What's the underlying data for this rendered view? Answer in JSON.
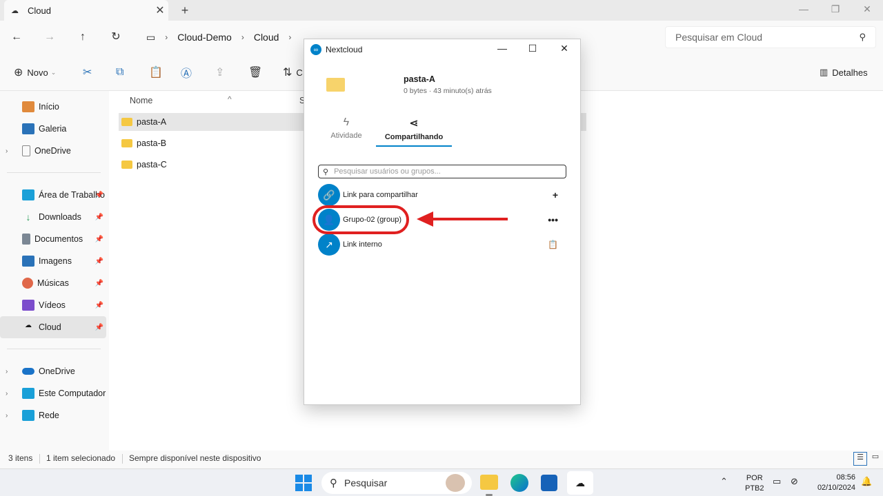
{
  "window": {
    "tab_title": "Cloud",
    "new_tab_symbol": "+",
    "close_symbol": "✕"
  },
  "nav": {
    "breadcrumb": [
      "Cloud-Demo",
      "Cloud"
    ],
    "search_placeholder": "Pesquisar em Cloud"
  },
  "commands": {
    "new_label": "Novo",
    "details_label": "Detalhes",
    "sort_label": "C"
  },
  "sidebar": {
    "items": [
      {
        "label": "Início",
        "icon": "home-icon",
        "color": "#e08a3c"
      },
      {
        "label": "Galeria",
        "icon": "gallery-icon",
        "color": "#2a72b8"
      },
      {
        "label": "OneDrive",
        "icon": "document-icon",
        "color": "#ffffff"
      },
      {
        "label": "Área de Trabalho",
        "icon": "desktop-icon",
        "color": "#1aa0d8"
      },
      {
        "label": "Downloads",
        "icon": "download-icon",
        "color": "#2a9d5a"
      },
      {
        "label": "Documentos",
        "icon": "documents-icon",
        "color": "#7b8794"
      },
      {
        "label": "Imagens",
        "icon": "pictures-icon",
        "color": "#2a72b8"
      },
      {
        "label": "Músicas",
        "icon": "music-icon",
        "color": "#e0684a"
      },
      {
        "label": "Vídeos",
        "icon": "videos-icon",
        "color": "#7c4dcc"
      },
      {
        "label": "Cloud",
        "icon": "nextcloud-icon",
        "color": "#333333"
      },
      {
        "label": "OneDrive",
        "icon": "onedrive-icon",
        "color": "#1a73c8"
      },
      {
        "label": "Este Computador",
        "icon": "computer-icon",
        "color": "#1aa0d8"
      },
      {
        "label": "Rede",
        "icon": "network-icon",
        "color": "#1aa0d8"
      }
    ]
  },
  "content": {
    "column_name": "Nome",
    "column_status": "S",
    "files": [
      "pasta-A",
      "pasta-B",
      "pasta-C"
    ]
  },
  "statusbar": {
    "count": "3 itens",
    "selected": "1 item selecionado",
    "availability": "Sempre disponível neste dispositivo"
  },
  "taskbar": {
    "search_label": "Pesquisar",
    "lang_top": "POR",
    "lang_bottom": "PTB2",
    "time": "08:56",
    "date": "02/10/2024"
  },
  "dialog": {
    "title": "Nextcloud",
    "file_name": "pasta-A",
    "file_meta": "0 bytes · 43 minuto(s) atrás",
    "tab_activity": "Atividade",
    "tab_sharing": "Compartilhando",
    "search_placeholder": "Pesquisar usuários ou grupos...",
    "shares": [
      {
        "label": "Link para compartilhar",
        "action": "+"
      },
      {
        "label": "Grupo-02 (group)",
        "action": "•••"
      },
      {
        "label": "Link interno",
        "action": "📋"
      }
    ]
  }
}
